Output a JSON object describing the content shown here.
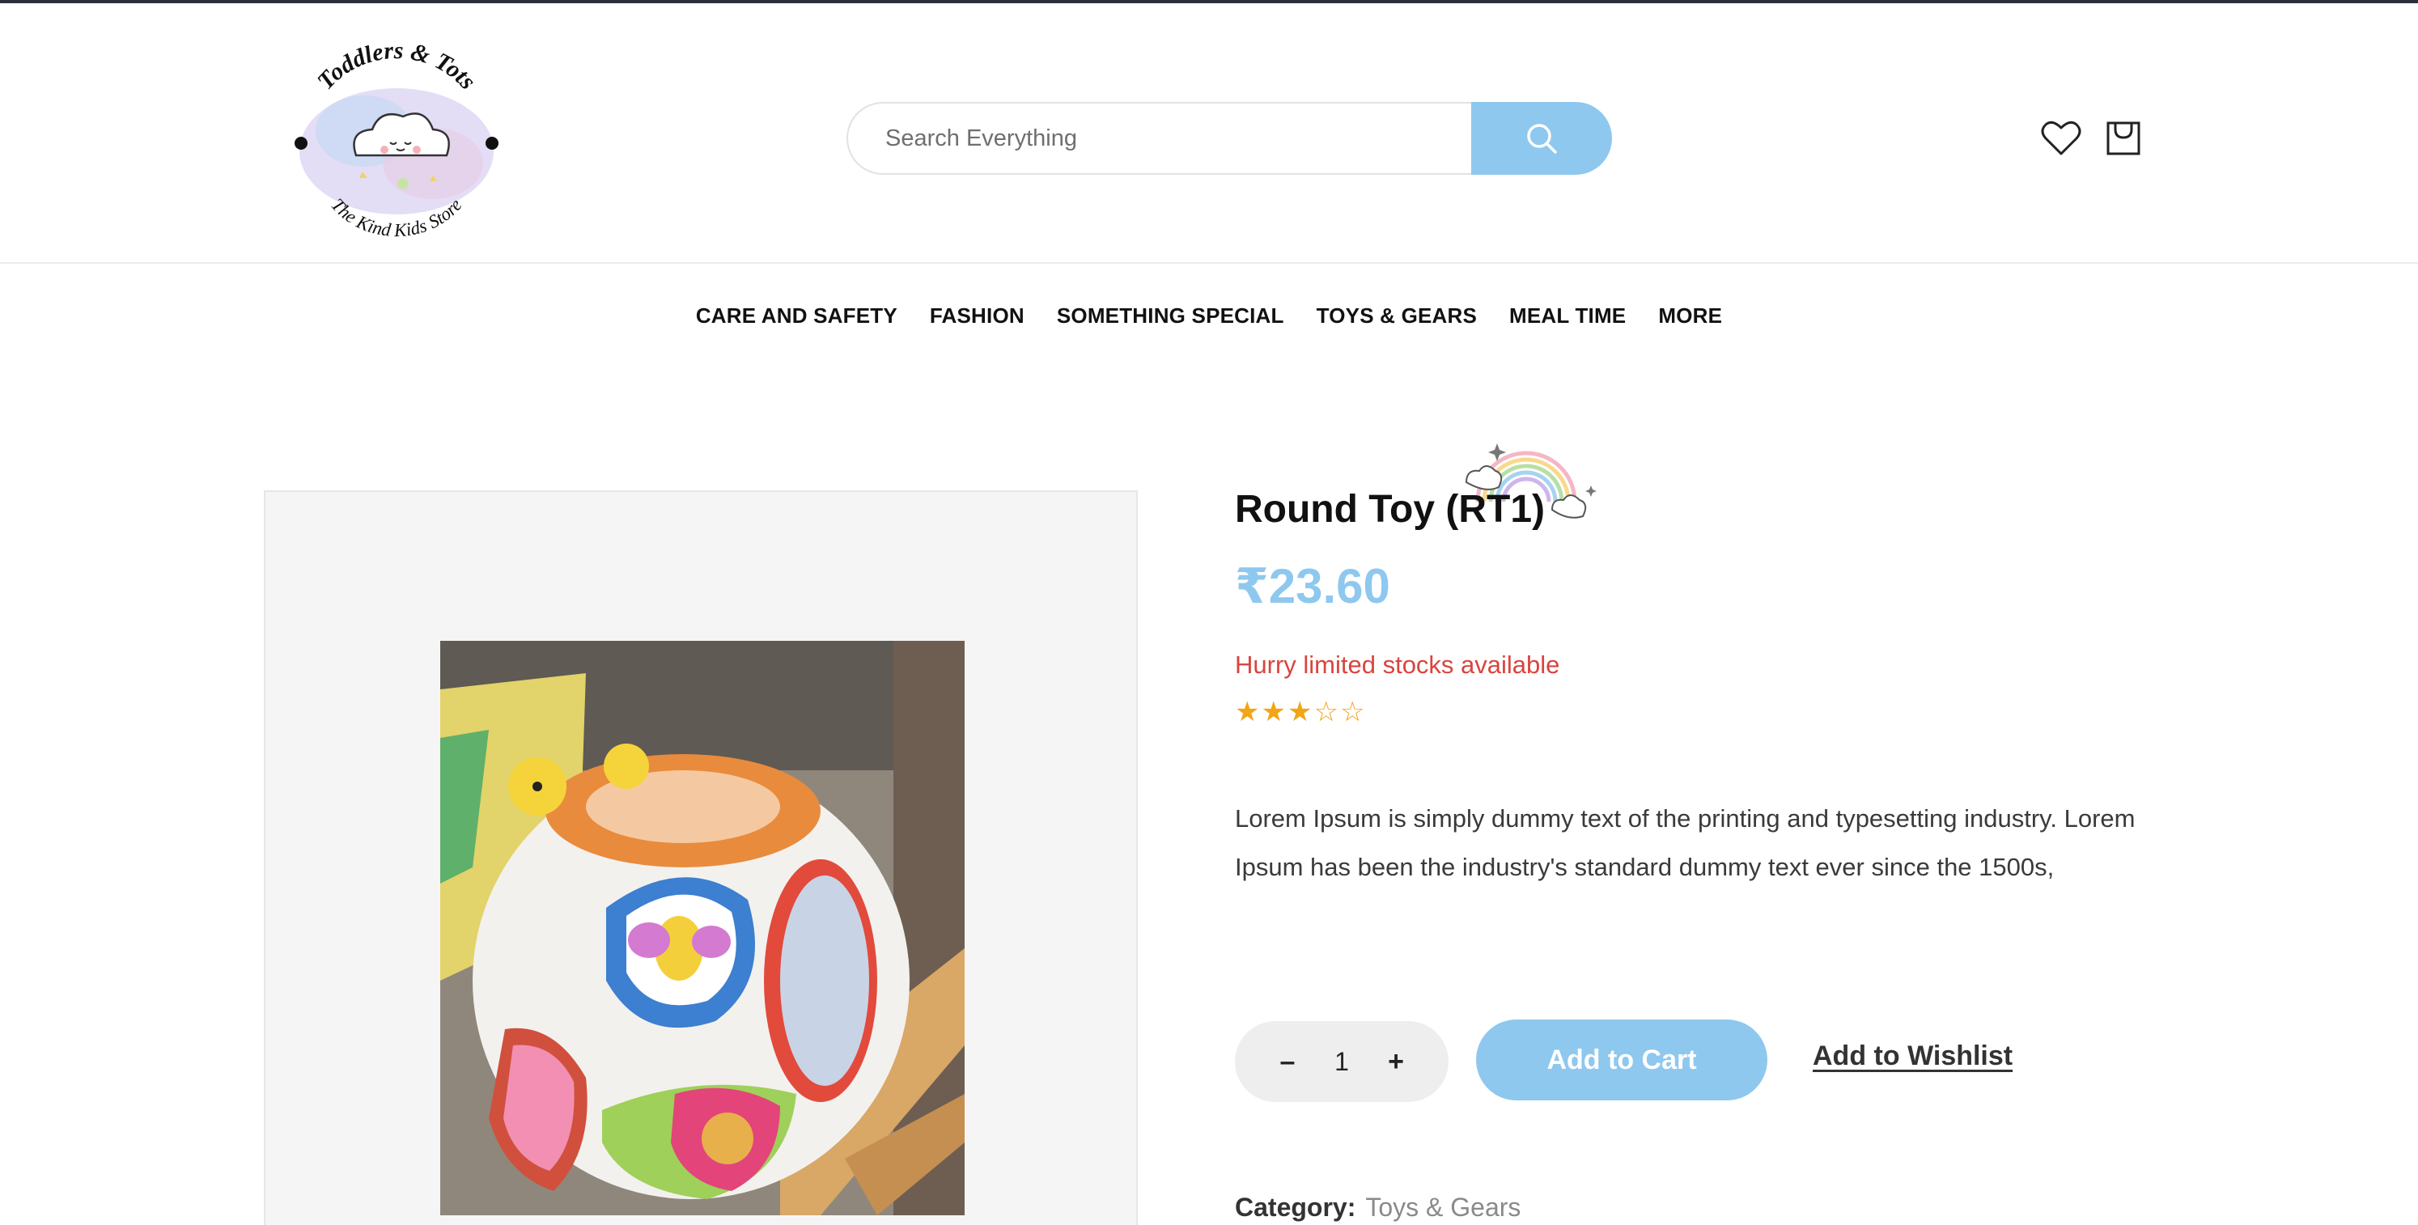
{
  "header": {
    "logo": {
      "top_text": "Toddlers & Tots",
      "bottom_text": "The Kind Kids Store",
      "icon": "cloud-logo-icon"
    },
    "search": {
      "placeholder": "Search Everything",
      "button_icon": "search-icon"
    },
    "icons": {
      "wishlist": "heart-icon",
      "cart": "shopping-bag-icon"
    }
  },
  "nav": {
    "items": [
      {
        "label": "CARE AND SAFETY"
      },
      {
        "label": "FASHION"
      },
      {
        "label": "SOMETHING SPECIAL"
      },
      {
        "label": "TOYS & GEARS"
      },
      {
        "label": "MEAL TIME"
      },
      {
        "label": "MORE"
      }
    ]
  },
  "product": {
    "title": "Round Toy (RT1)",
    "price": "₹23.60",
    "stock_note": "Hurry limited stocks available",
    "rating": {
      "filled": 3,
      "total": 5
    },
    "description": "Lorem Ipsum is simply dummy text of the printing and typesetting industry. Lorem Ipsum has been the industry's standard dummy text ever since the 1500s,",
    "quantity": "1",
    "qty_minus": "–",
    "qty_plus": "+",
    "add_to_cart_label": "Add to Cart",
    "add_to_wishlist_label": "Add to Wishlist",
    "category_label": "Category:",
    "category_value": "Toys & Gears",
    "decor_icon": "rainbow-icon",
    "image_icon": "round-toy-photo"
  },
  "colors": {
    "accent": "#8ec8ee",
    "stock_warning": "#d9443f",
    "star": "#f2a516",
    "text": "#111111"
  }
}
